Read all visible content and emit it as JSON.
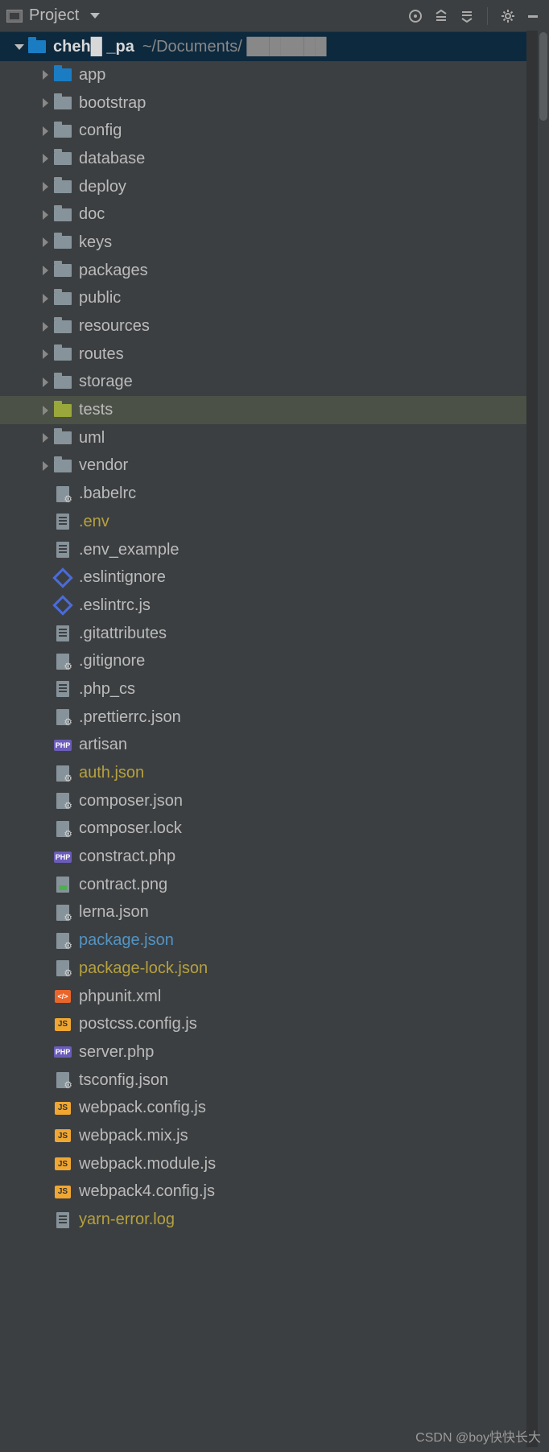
{
  "toolbar": {
    "title": "Project"
  },
  "root": {
    "name": "cheh█  _pa",
    "path": "~/Documents/ ███████"
  },
  "folders": [
    {
      "name": "app",
      "icon": "folder-app"
    },
    {
      "name": "bootstrap",
      "icon": "folder-closed"
    },
    {
      "name": "config",
      "icon": "folder-closed"
    },
    {
      "name": "database",
      "icon": "folder-closed"
    },
    {
      "name": "deploy",
      "icon": "folder-closed"
    },
    {
      "name": "doc",
      "icon": "folder-closed"
    },
    {
      "name": "keys",
      "icon": "folder-closed"
    },
    {
      "name": "packages",
      "icon": "folder-closed"
    },
    {
      "name": "public",
      "icon": "folder-closed"
    },
    {
      "name": "resources",
      "icon": "folder-closed"
    },
    {
      "name": "routes",
      "icon": "folder-closed"
    },
    {
      "name": "storage",
      "icon": "folder-closed"
    },
    {
      "name": "tests",
      "icon": "folder-tests",
      "selected": true
    },
    {
      "name": "uml",
      "icon": "folder-closed"
    },
    {
      "name": "vendor",
      "icon": "folder-closed"
    }
  ],
  "files": [
    {
      "name": ".babelrc",
      "icon": "file-cog",
      "color": ""
    },
    {
      "name": ".env",
      "icon": "file-generic",
      "color": "accent-yellow"
    },
    {
      "name": ".env_example",
      "icon": "file-generic",
      "color": ""
    },
    {
      "name": ".eslintignore",
      "icon": "file-eslint",
      "color": ""
    },
    {
      "name": ".eslintrc.js",
      "icon": "file-eslint",
      "color": ""
    },
    {
      "name": ".gitattributes",
      "icon": "file-generic",
      "color": ""
    },
    {
      "name": ".gitignore",
      "icon": "file-cog",
      "color": ""
    },
    {
      "name": ".php_cs",
      "icon": "file-generic",
      "color": ""
    },
    {
      "name": ".prettierrc.json",
      "icon": "file-cog",
      "color": ""
    },
    {
      "name": "artisan",
      "icon": "file-php",
      "color": ""
    },
    {
      "name": "auth.json",
      "icon": "file-cog",
      "color": "accent-yellow"
    },
    {
      "name": "composer.json",
      "icon": "file-cog",
      "color": ""
    },
    {
      "name": "composer.lock",
      "icon": "file-cog",
      "color": ""
    },
    {
      "name": "constract.php",
      "icon": "file-php",
      "color": ""
    },
    {
      "name": "contract.png",
      "icon": "file-img",
      "color": ""
    },
    {
      "name": "lerna.json",
      "icon": "file-cog",
      "color": ""
    },
    {
      "name": "package.json",
      "icon": "file-cog",
      "color": "accent-blue"
    },
    {
      "name": "package-lock.json",
      "icon": "file-cog",
      "color": "accent-yellow"
    },
    {
      "name": "phpunit.xml",
      "icon": "file-xml",
      "color": ""
    },
    {
      "name": "postcss.config.js",
      "icon": "file-js",
      "color": ""
    },
    {
      "name": "server.php",
      "icon": "file-php",
      "color": ""
    },
    {
      "name": "tsconfig.json",
      "icon": "file-cog",
      "color": ""
    },
    {
      "name": "webpack.config.js",
      "icon": "file-js",
      "color": ""
    },
    {
      "name": "webpack.mix.js",
      "icon": "file-js",
      "color": ""
    },
    {
      "name": "webpack.module.js",
      "icon": "file-js",
      "color": ""
    },
    {
      "name": "webpack4.config.js",
      "icon": "file-js",
      "color": ""
    },
    {
      "name": "yarn-error.log",
      "icon": "file-generic",
      "color": "accent-yellow"
    }
  ],
  "watermark": "CSDN @boy快快长大"
}
